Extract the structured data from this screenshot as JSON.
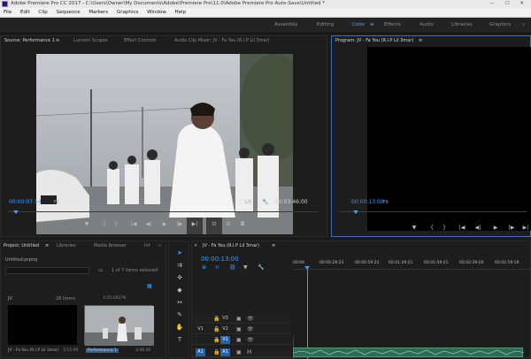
{
  "window": {
    "title": "Adobe Premiere Pro CC 2017 - C:\\Users\\Owner\\My Documents\\Adobe\\Premiere Pro\\11.0\\Adobe Premiere Pro Auto-Save\\Untitled *",
    "controls": "— ☐ ✕"
  },
  "menu": [
    "File",
    "Edit",
    "Clip",
    "Sequence",
    "Markers",
    "Graphics",
    "Window",
    "Help"
  ],
  "workspaces": {
    "items": [
      "Assembly",
      "Editing",
      "Color",
      "Effects",
      "Audio",
      "Libraries",
      "Graphics"
    ],
    "active": "Color",
    "active_menu": "≡",
    "more": "»"
  },
  "source_monitor": {
    "tabs": [
      "Source: Performance 1",
      "Lumetri Scopes",
      "Effect Controls",
      "Audio Clip Mixer: JV - Fa You (R.I.P Lil 3mar)"
    ],
    "tab_menu": "≡",
    "timecode": "00:00:07:14",
    "fit": "Fit",
    "resolution": "1/8",
    "duration": "00:03:46:00"
  },
  "program_monitor": {
    "tab": "Program: JV - Fa You (R.I.P Lil 3mar)",
    "tab_menu": "≡",
    "timecode": "00:00:13:00",
    "fit": "Fit"
  },
  "transport": {
    "marker": "▼",
    "mark_in": "{",
    "mark_out": "}",
    "go_in": "|◀",
    "step_back": "◀|",
    "play": "▶",
    "step_fwd": "|▶",
    "go_out": "▶|",
    "insert": "⊡",
    "overwrite": "⊟",
    "export": "◘",
    "lift": "⊐",
    "extract": "⊏"
  },
  "project_panel": {
    "tabs": [
      "Project: Untitled",
      "Libraries",
      "Media Browser",
      "Inf"
    ],
    "tab_menu": "≡",
    "more": "»",
    "file": "Untitled.prproj",
    "selection": "1 of 7 items selected",
    "search_placeholder": "",
    "items": [
      {
        "name": "JV",
        "meta": "28 Items"
      },
      {
        "name": "",
        "meta": ""
      }
    ],
    "bottom": [
      {
        "name": "JV - Fa You (R.I.P Lil 3mar)",
        "duration": "3:15:09"
      },
      {
        "name": "Performance 1",
        "duration": "3:46:00"
      }
    ],
    "thumb_duration": "3:15:29479"
  },
  "timeline": {
    "tab": "JV - Fa You (R.I.P Lil 3mar)",
    "tab_menu": "≡",
    "close": "✕",
    "timecode": "00:00:13:00",
    "ruler": [
      "00:00",
      "00:00:29:23",
      "00:00:59:22",
      "00:01:29:21",
      "00:01:59:21",
      "00:02:29:20",
      "00:02:59:19"
    ],
    "tracks": [
      {
        "target": "",
        "name": "V3"
      },
      {
        "target": "V1",
        "name": "V2"
      },
      {
        "target": "",
        "name": "V1"
      },
      {
        "target": "A1",
        "name": "A1"
      }
    ]
  },
  "colors": {
    "accent": "#3f9bff",
    "active_track": "#2361a8",
    "panel": "#1d1d1d",
    "audio_clip": "#2e6b55"
  }
}
